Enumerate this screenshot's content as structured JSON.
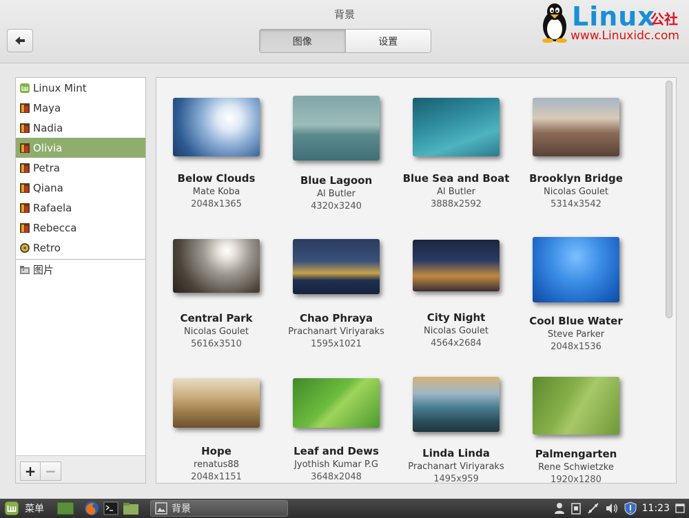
{
  "window": {
    "title": "背景",
    "tabs": [
      {
        "label": "图像",
        "active": true
      },
      {
        "label": "设置",
        "active": false
      }
    ]
  },
  "watermark": {
    "brand": "Linux",
    "brand_cn": "公社",
    "url": "www.Linuxidc.com"
  },
  "sidebar": {
    "items": [
      {
        "label": "Linux Mint",
        "icon": "mint-icon",
        "selected": false
      },
      {
        "label": "Maya",
        "icon": "wallpaper-icon",
        "selected": false
      },
      {
        "label": "Nadia",
        "icon": "wallpaper-icon",
        "selected": false
      },
      {
        "label": "Olivia",
        "icon": "wallpaper-icon",
        "selected": true
      },
      {
        "label": "Petra",
        "icon": "wallpaper-icon",
        "selected": false
      },
      {
        "label": "Qiana",
        "icon": "wallpaper-icon",
        "selected": false
      },
      {
        "label": "Rafaela",
        "icon": "wallpaper-icon",
        "selected": false
      },
      {
        "label": "Rebecca",
        "icon": "wallpaper-icon",
        "selected": false
      },
      {
        "label": "Retro",
        "icon": "retro-icon",
        "selected": false
      }
    ],
    "folder": {
      "label": "图片",
      "icon": "pictures-folder-icon"
    },
    "add_label": "+",
    "remove_label": "−"
  },
  "wallpapers": [
    {
      "name": "Below Clouds",
      "author": "Mate Koba",
      "size": "2048x1365"
    },
    {
      "name": "Blue Lagoon",
      "author": "Al Butler",
      "size": "4320x3240"
    },
    {
      "name": "Blue Sea and Boat",
      "author": "Al Butler",
      "size": "3888x2592"
    },
    {
      "name": "Brooklyn Bridge",
      "author": "Nicolas Goulet",
      "size": "5314x3542"
    },
    {
      "name": "Central Park",
      "author": "Nicolas Goulet",
      "size": "5616x3510"
    },
    {
      "name": "Chao Phraya",
      "author": "Prachanart Viriyaraks",
      "size": "1595x1021"
    },
    {
      "name": "City Night",
      "author": "Nicolas Goulet",
      "size": "4564x2684"
    },
    {
      "name": "Cool Blue Water",
      "author": "Steve Parker",
      "size": "2048x1536"
    },
    {
      "name": "Hope",
      "author": "renatus88",
      "size": "2048x1151"
    },
    {
      "name": "Leaf and Dews",
      "author": "Jyothish Kumar P.G",
      "size": "3648x2048"
    },
    {
      "name": "Linda Linda",
      "author": "Prachanart Viriyaraks",
      "size": "1495x959"
    },
    {
      "name": "Palmengarten",
      "author": "Rene Schwietzke",
      "size": "1920x1280"
    }
  ],
  "taskbar": {
    "menu_label": "菜单",
    "window_label": "背景",
    "clock": "11:23"
  }
}
